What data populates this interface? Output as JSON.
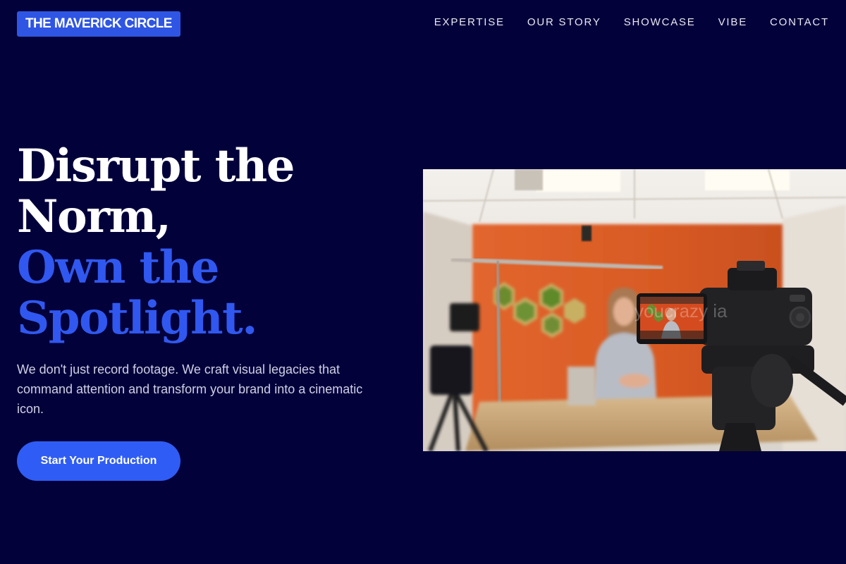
{
  "brand": {
    "logo_text": "THE MAVERICK CIRCLE",
    "accent_color": "#2f55e4",
    "background_color": "#03013a"
  },
  "nav": {
    "items": [
      {
        "label": "EXPERTISE"
      },
      {
        "label": "OUR STORY"
      },
      {
        "label": "SHOWCASE"
      },
      {
        "label": "VIBE"
      },
      {
        "label": "CONTACT"
      }
    ]
  },
  "hero": {
    "headline_line1": "Disrupt the",
    "headline_line2": "Norm,",
    "headline_line3": "Own the",
    "headline_line4": "Spotlight.",
    "subtext": "We don't just record footage. We craft visual legacies that command attention and transform your brand into a cinematic icon.",
    "cta_label": "Start Your Production",
    "image": {
      "description_icon": "studio-camera-photo",
      "watermark_text": "youcrazy ia"
    }
  }
}
